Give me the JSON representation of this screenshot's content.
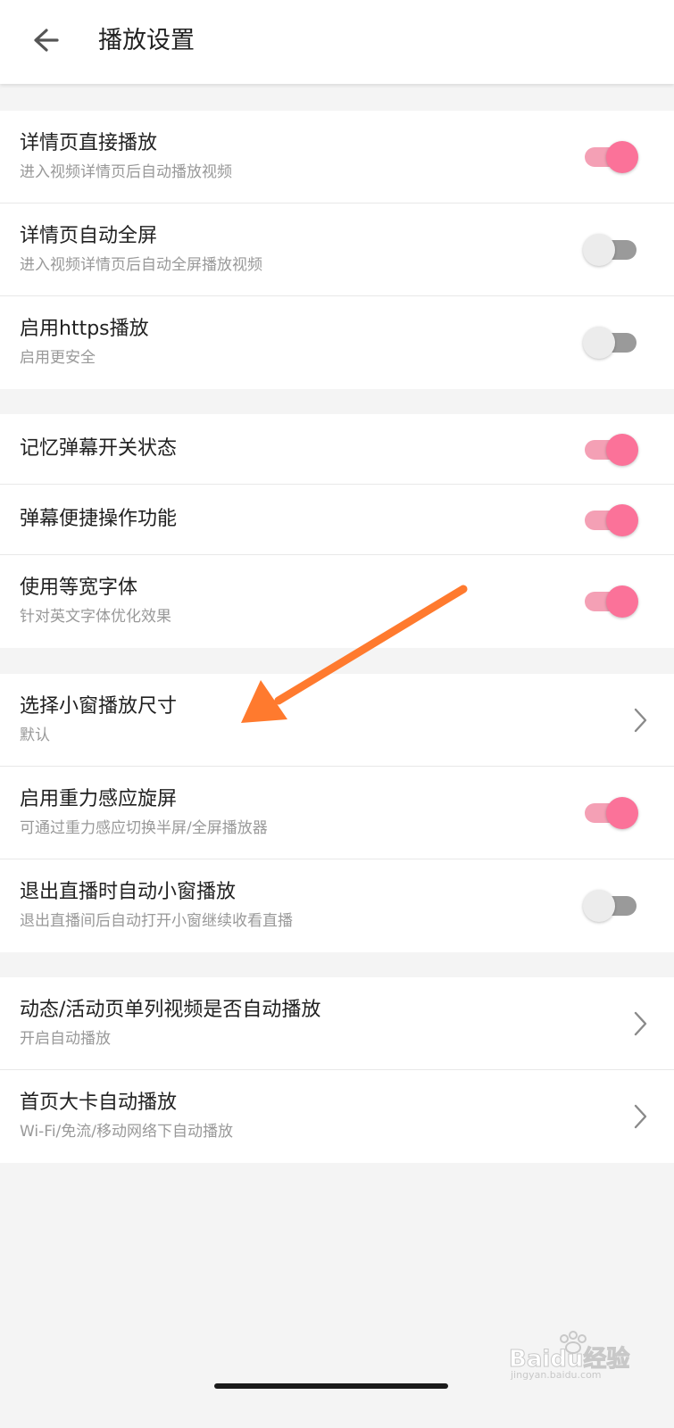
{
  "header": {
    "title": "播放设置",
    "back_icon": "arrow-left-icon"
  },
  "colors": {
    "accent": "#fb7299",
    "accent_track": "#f4a0b5",
    "off_track": "#9a9a9a",
    "off_knob": "#ececec",
    "annotation_arrow": "#ff7a2e"
  },
  "group1": {
    "items": [
      {
        "title": "详情页直接播放",
        "subtitle": "进入视频详情页后自动播放视频",
        "toggle": "on"
      },
      {
        "title": "详情页自动全屏",
        "subtitle": "进入视频详情页后自动全屏播放视频",
        "toggle": "off"
      },
      {
        "title": "启用https播放",
        "subtitle": "启用更安全",
        "toggle": "off"
      }
    ]
  },
  "group2": {
    "items": [
      {
        "title": "记忆弹幕开关状态",
        "toggle": "on"
      },
      {
        "title": "弹幕便捷操作功能",
        "toggle": "on"
      },
      {
        "title": "使用等宽字体",
        "subtitle": "针对英文字体优化效果",
        "toggle": "on"
      }
    ]
  },
  "group3": {
    "items": [
      {
        "title": "选择小窗播放尺寸",
        "subtitle": "默认",
        "icon": "chevron-right-icon"
      },
      {
        "title": "启用重力感应旋屏",
        "subtitle": "可通过重力感应切换半屏/全屏播放器",
        "toggle": "on"
      },
      {
        "title": "退出直播时自动小窗播放",
        "subtitle": "退出直播间后自动打开小窗继续收看直播",
        "toggle": "off"
      }
    ]
  },
  "group4": {
    "items": [
      {
        "title": "动态/活动页单列视频是否自动播放",
        "subtitle": "开启自动播放",
        "icon": "chevron-right-icon"
      },
      {
        "title": "首页大卡自动播放",
        "subtitle": "Wi-Fi/免流/移动网络下自动播放",
        "icon": "chevron-right-icon"
      }
    ]
  },
  "watermark": {
    "brand": "Baidu经验",
    "sub": "jingyan.baidu.com"
  }
}
